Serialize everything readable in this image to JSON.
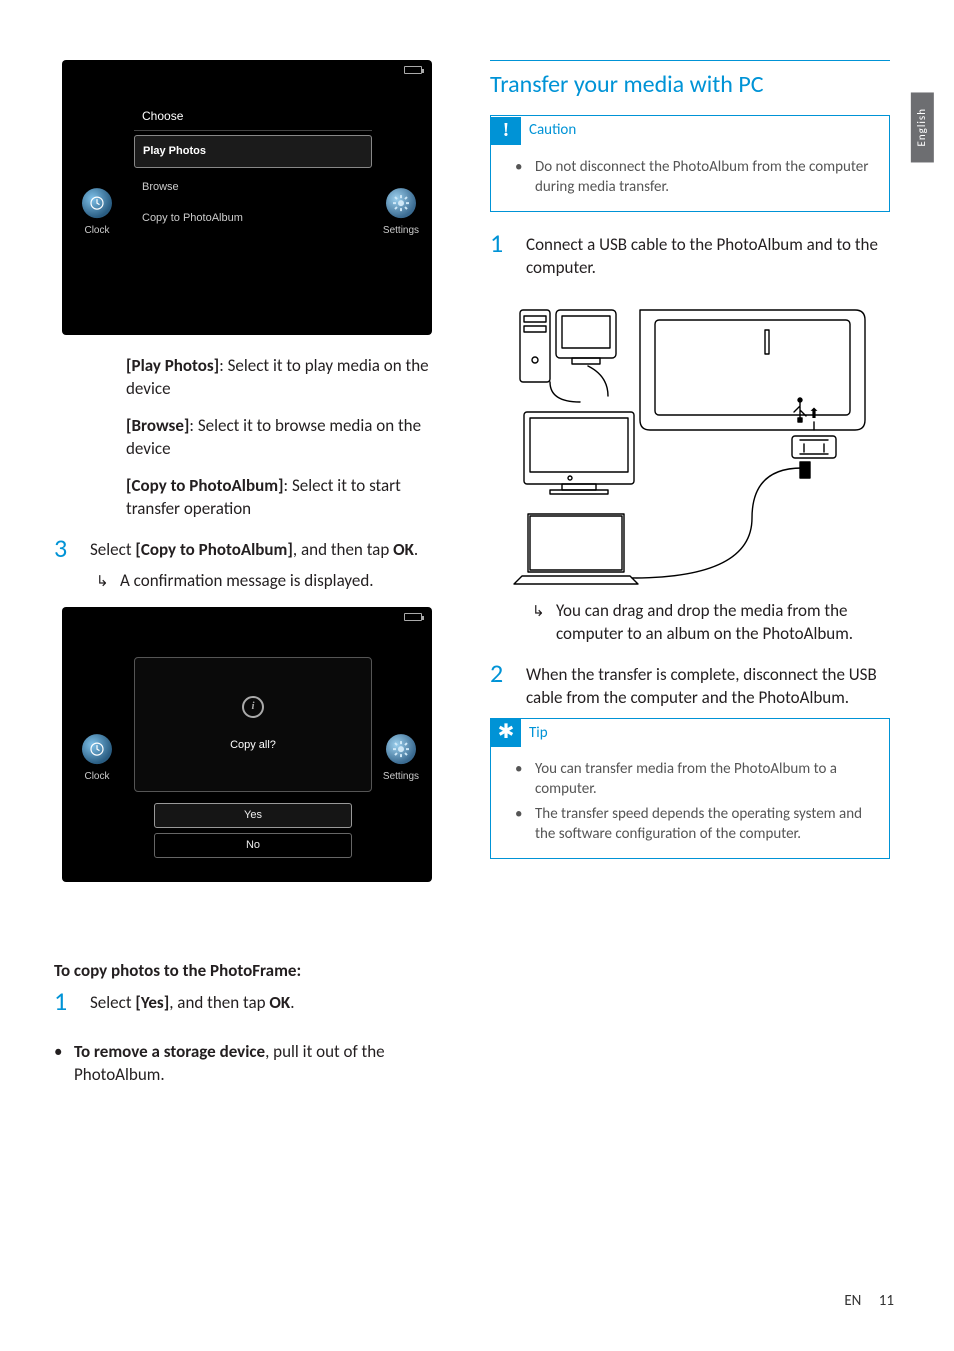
{
  "lang_tab": "English",
  "footer": {
    "lang": "EN",
    "page": "11"
  },
  "left_col": {
    "shot1": {
      "title": "Choose",
      "opt_selected": "Play Photos",
      "opt2": "Browse",
      "opt3": "Copy to PhotoAlbum",
      "side_left": "Clock",
      "side_right": "Settings"
    },
    "options": {
      "play_term": "[Play Photos]",
      "play_desc": ": Select it to play media on the device",
      "browse_term": "[Browse]",
      "browse_desc": ": Select it to browse media on the device",
      "copy_term": "[Copy to PhotoAlbum]",
      "copy_desc": ": Select it to start transfer operation"
    },
    "step3": {
      "num": "3",
      "pre": "Select ",
      "term": "[Copy to PhotoAlbum]",
      "mid": ", and then tap ",
      "ok": "OK",
      "post": "."
    },
    "step3_result": "A confirmation message is displayed.",
    "shot2": {
      "prompt": "Copy all?",
      "yes": "Yes",
      "no": "No",
      "side_left": "Clock",
      "side_right": "Settings"
    },
    "sub_head": "To copy photos to the PhotoFrame:",
    "step1b": {
      "num": "1",
      "pre": "Select ",
      "term": "[Yes]",
      "mid": ", and then tap ",
      "ok": "OK",
      "post": "."
    },
    "remove": {
      "lead": "To remove a storage device",
      "rest": ", pull it out of the PhotoAlbum."
    }
  },
  "right_col": {
    "title": "Transfer your media with PC",
    "caution": {
      "label": "Caution",
      "text": "Do not disconnect the PhotoAlbum from the computer during media transfer."
    },
    "step1": {
      "num": "1",
      "text": "Connect a USB cable to the PhotoAlbum and to the computer."
    },
    "step1_result": "You can drag and drop the media from the computer to an album on the PhotoAlbum.",
    "step2": {
      "num": "2",
      "text": "When the transfer is complete, disconnect the USB cable from the computer and the PhotoAlbum."
    },
    "tip": {
      "label": "Tip",
      "items": [
        "You can transfer media from the PhotoAlbum to a computer.",
        "The transfer speed depends the operating system and the software configuration of the computer."
      ]
    }
  }
}
